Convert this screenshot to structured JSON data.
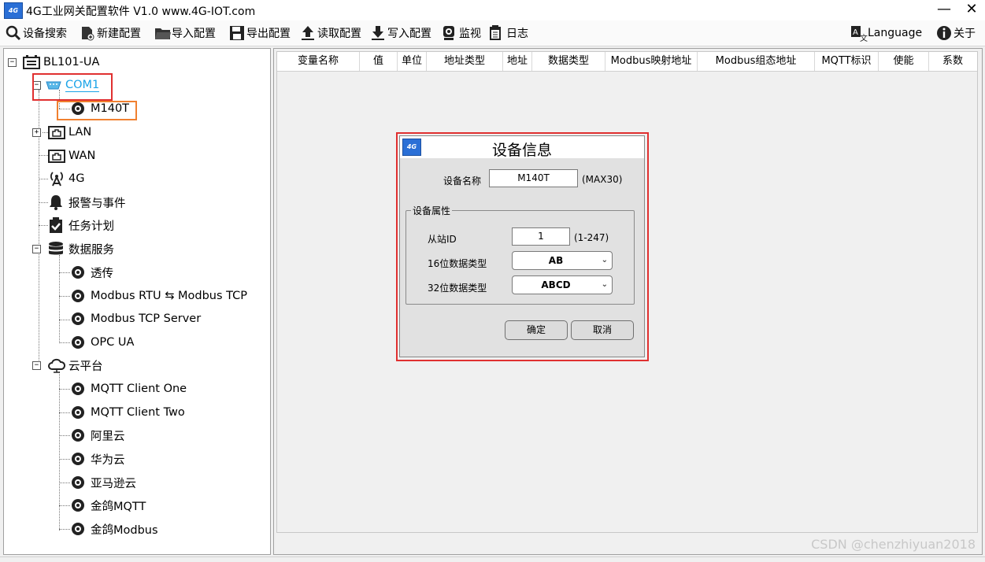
{
  "window": {
    "title": "4G工业网关配置软件 V1.0 www.4G-IOT.com",
    "minimize": "—",
    "close": "✕"
  },
  "toolbar": {
    "items": [
      {
        "label": "设备搜索",
        "icon": "search-icon"
      },
      {
        "label": "新建配置",
        "icon": "new-file-icon"
      },
      {
        "label": "导入配置",
        "icon": "folder-icon"
      },
      {
        "label": "导出配置",
        "icon": "save-icon"
      },
      {
        "label": "读取配置",
        "icon": "upload-icon"
      },
      {
        "label": "写入配置",
        "icon": "download-icon"
      },
      {
        "label": "监视",
        "icon": "monitor-icon"
      },
      {
        "label": "日志",
        "icon": "log-icon"
      }
    ],
    "language": "Language",
    "about": "关于"
  },
  "tree": {
    "root": "BL101-UA",
    "com1": "COM1",
    "m140t": "M140T",
    "lan": "LAN",
    "wan": "WAN",
    "g4": "4G",
    "alarm": "报警与事件",
    "task": "任务计划",
    "data_service": "数据服务",
    "ds_items": [
      "透传",
      "Modbus RTU ⇆ Modbus TCP",
      "Modbus TCP Server",
      "OPC UA"
    ],
    "cloud": "云平台",
    "cloud_items": [
      "MQTT Client One",
      "MQTT Client Two",
      "阿里云",
      "华为云",
      "亚马逊云",
      "金鸽MQTT",
      "金鸽Modbus"
    ]
  },
  "grid": {
    "columns": [
      "变量名称",
      "值",
      "单位",
      "地址类型",
      "地址",
      "数据类型",
      "Modbus映射地址",
      "Modbus组态地址",
      "MQTT标识",
      "使能",
      "系数"
    ]
  },
  "dialog": {
    "title": "设备信息",
    "device_name_label": "设备名称",
    "device_name_value": "M140T",
    "device_name_hint": "(MAX30)",
    "group_title": "设备属性",
    "slave_id_label": "从站ID",
    "slave_id_value": "1",
    "slave_id_hint": "(1-247)",
    "type16_label": "16位数据类型",
    "type16_value": "AB",
    "type32_label": "32位数据类型",
    "type32_value": "ABCD",
    "ok": "确定",
    "cancel": "取消"
  },
  "watermark": "CSDN @chenzhiyuan2018",
  "colors": {
    "highlight_red": "#e03030",
    "highlight_orange": "#f08030",
    "selected_text": "#1aa3e8"
  }
}
